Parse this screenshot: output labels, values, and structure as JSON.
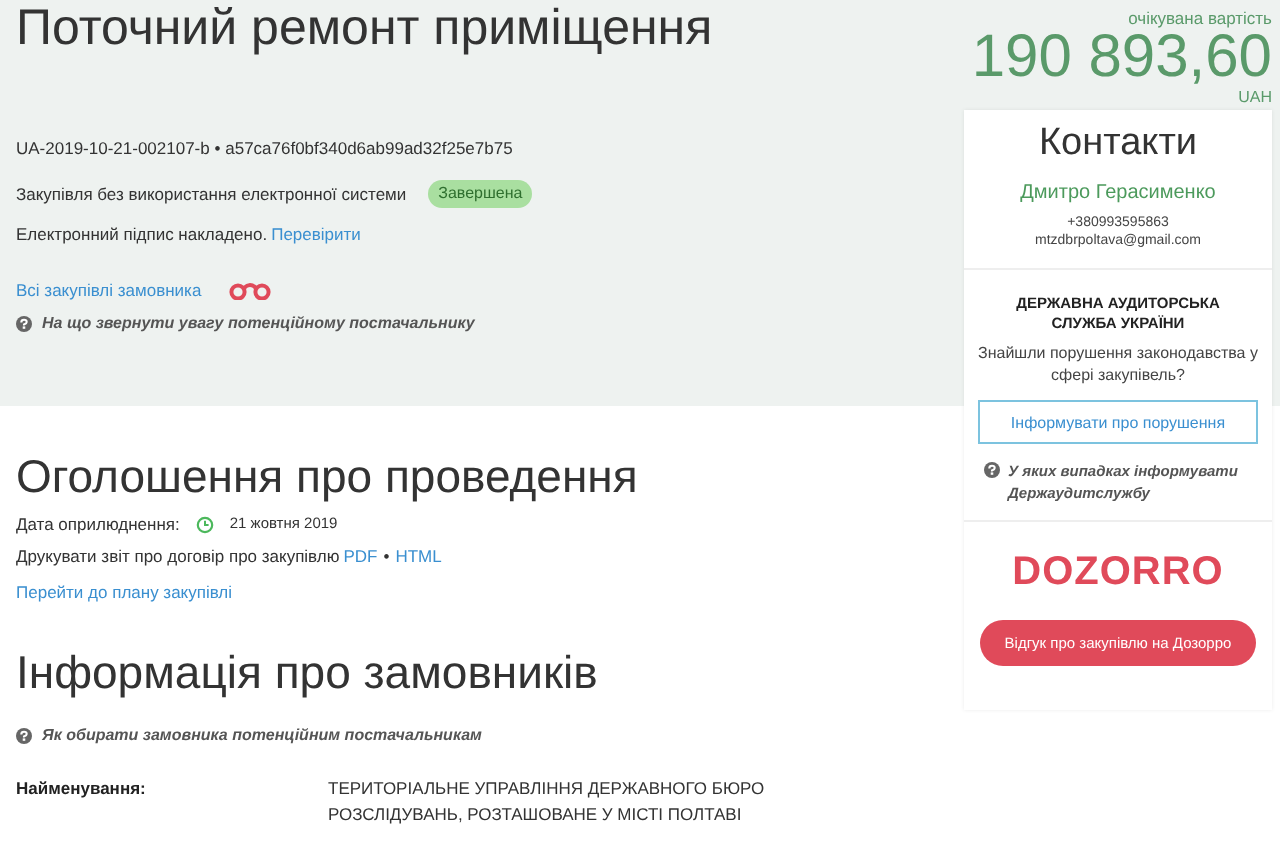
{
  "title": "Поточний ремонт приміщення",
  "tender": {
    "id": "UA-2019-10-21-002107-b",
    "separator": "•",
    "hash": "a57ca76f0bf340d6ab99ad32f25e7b75",
    "method": "Закупівля без використання електронної системи",
    "status": {
      "label": "Завершена",
      "color": "#a9dfa0"
    },
    "signature": "Електронний підпис накладено.",
    "verify_link": "Перевірити",
    "customer_link": "Всі закупівлі замовника",
    "hint": "На що звернути увагу потенційному постачальнику"
  },
  "price": {
    "label": "очікувана вартість",
    "amount": "190 893,60",
    "currency": "UAH"
  },
  "contacts": {
    "title": "Контакти",
    "name": "Дмитро Герасименко",
    "phone": "+380993595863",
    "email": "mtzdbrpoltava@gmail.com"
  },
  "audit": {
    "org": "ДЕРЖАВНА АУДИТОРСЬКА СЛУЖБА УКРАЇНИ",
    "question": "Знайшли порушення законодавства у сфері закупівель?",
    "button": "Інформувати про порушення",
    "hint": "У яких випадках інформувати Держаудитслужбу"
  },
  "dozorro": {
    "logo": "DOZORRO",
    "button": "Відгук про закупівлю на Дозорро"
  },
  "announcement": {
    "heading": "Оголошення про проведення",
    "date_label": "Дата оприлюднення:",
    "date": "21 жовтня 2019",
    "print_label": "Друкувати звіт про договір про закупівлю",
    "links": [
      "PDF",
      "HTML"
    ],
    "separator": "•",
    "plan_link": "Перейти до плану закупівлі"
  },
  "customers": {
    "heading": "Інформація про замовників",
    "hint": "Як обирати замовника потенційним постачальникам",
    "rows": [
      {
        "label": "Найменування:",
        "value": "ТЕРИТОРІАЛЬНЕ УПРАВЛІННЯ ДЕРЖАВНОГО БЮРО РОЗСЛІДУВАНЬ, РОЗТАШОВАНЕ У МІСТІ ПОЛТАВІ"
      }
    ]
  }
}
